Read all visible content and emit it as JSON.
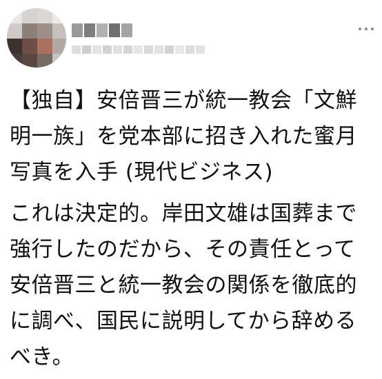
{
  "tweet": {
    "author": {
      "avatar_icon": "user-avatar-icon",
      "name_blurred": true,
      "handle_blurred": true
    },
    "more_icon": "more-options-icon",
    "paragraphs": [
      {
        "lines": [
          "【独自】安倍晋三が統一教会「文鮮",
          "明一族」を党本部に招き入れた蜜月",
          "写真を入手 (現代ビジネス)"
        ]
      },
      {
        "lines": [
          "これは決定的。岸田文雄は国葬まで",
          "強行したのだから、その責任とって",
          "安倍晋三と統一教会の関係を徹底的",
          "に調べ、国民に説明してから辞める",
          "べき。"
        ]
      }
    ]
  }
}
